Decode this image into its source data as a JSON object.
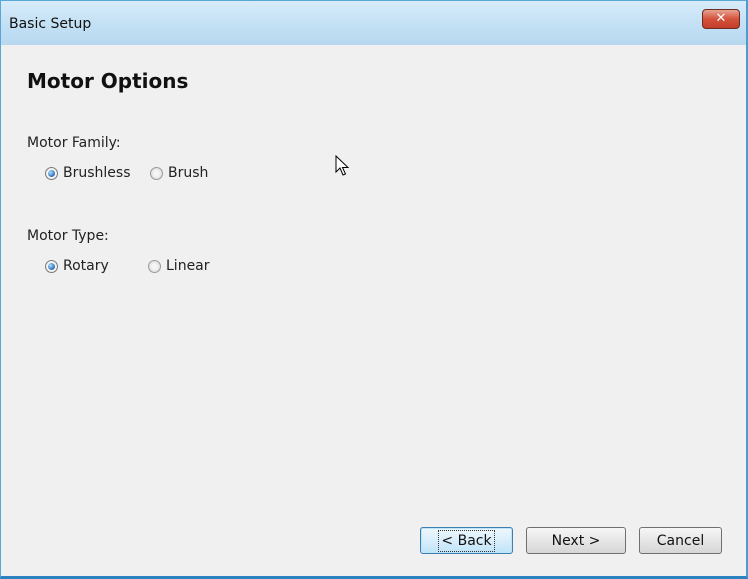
{
  "window": {
    "title": "Basic Setup",
    "close_label": "✕"
  },
  "page": {
    "heading": "Motor Options"
  },
  "motor_family": {
    "label": "Motor Family:",
    "options": [
      {
        "label": "Brushless",
        "selected": true
      },
      {
        "label": "Brush",
        "selected": false
      }
    ]
  },
  "motor_type": {
    "label": "Motor Type:",
    "options": [
      {
        "label": "Rotary",
        "selected": true
      },
      {
        "label": "Linear",
        "selected": false
      }
    ]
  },
  "buttons": {
    "back": "< Back",
    "next": "Next >",
    "cancel": "Cancel"
  },
  "icons": {
    "close": "close-icon",
    "cursor": "mouse-pointer-icon"
  },
  "colors": {
    "accent": "#2a6ab6",
    "close": "#c33e2a",
    "title_bar": "#c3e0f4"
  }
}
